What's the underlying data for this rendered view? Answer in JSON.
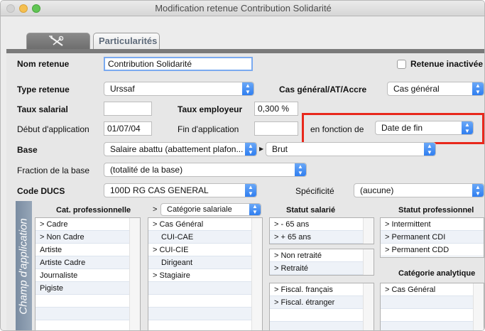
{
  "window": {
    "title": "Modification retenue Contribution Solidarité"
  },
  "tabs": {
    "first_icon": "tools-icon",
    "second": "Particularités"
  },
  "form": {
    "nom_retenue_label": "Nom retenue",
    "nom_retenue_value": "Contribution Solidarité",
    "retenue_inactivee_label": "Retenue inactivée",
    "retenue_inactivee_checked": false,
    "type_retenue_label": "Type retenue",
    "type_retenue_value": "Urssaf",
    "cas_general_label": "Cas général/AT/Accre",
    "cas_general_value": "Cas général",
    "taux_salarial_label": "Taux salarial",
    "taux_salarial_value": "",
    "taux_employeur_label": "Taux employeur",
    "taux_employeur_value": "0,300 %",
    "debut_label": "Début d'application",
    "debut_value": "01/07/04",
    "fin_label": "Fin d'application",
    "fin_value": "",
    "en_fonction_label": "en fonction de",
    "en_fonction_value": "Date de fin",
    "base_label": "Base",
    "base_value": "Salaire abattu (abattement plafon...",
    "base_second_value": "Brut",
    "fraction_label": "Fraction de la base",
    "fraction_value": "(totalité de la base)",
    "code_ducs_label": "Code DUCS",
    "code_ducs_value": "100D  RG CAS GENERAL",
    "specificite_label": "Spécificité",
    "specificite_value": "(aucune)"
  },
  "champ": {
    "sidebar_label": "Champ d'application",
    "cat_pro_header": "Cat. professionnelle",
    "cat_pro_items": [
      "> Cadre",
      "> Non Cadre",
      "Artiste",
      "Artiste Cadre",
      "Journaliste",
      "Pigiste",
      "",
      ""
    ],
    "cat_sal_prefix": ">",
    "cat_sal_select": "Catégorie salariale",
    "cat_sal_items": [
      "> Cas Général",
      "CUI-CAE",
      "> CUI-CIE",
      "Dirigeant",
      "> Stagiaire",
      "",
      "",
      ""
    ],
    "statut_salarie_header": "Statut salarié",
    "statut_salarie_age": [
      "> - 65 ans",
      "> + 65 ans"
    ],
    "statut_salarie_retraite": [
      "> Non retraité",
      "> Retraité"
    ],
    "statut_salarie_fiscal": [
      "> Fiscal. français",
      "> Fiscal. étranger",
      "",
      ""
    ],
    "statut_pro_header": "Statut professionnel",
    "statut_pro_items": [
      "> Intermittent",
      "> Permanent CDI",
      "> Permanent CDD"
    ],
    "cat_analytique_header": "Catégorie analytique",
    "cat_analytique_items": [
      "> Cas Général",
      "",
      "",
      ""
    ]
  },
  "colors": {
    "accent": "#2f7ef0",
    "highlight": "#e8281c",
    "sidebar": "#8797ab"
  }
}
